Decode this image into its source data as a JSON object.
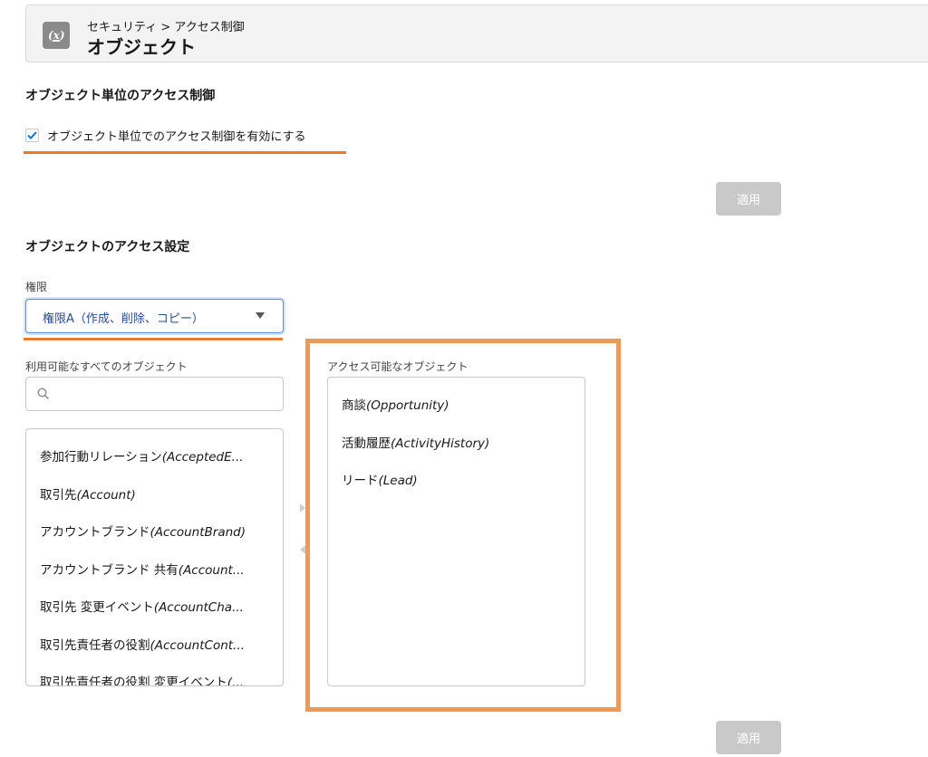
{
  "header": {
    "breadcrumb": "セキュリティ > アクセス制御",
    "title": "オブジェクト",
    "icon": "variable-icon"
  },
  "object_level": {
    "section_title": "オブジェクト単位のアクセス制御",
    "checkbox_label": "オブジェクト単位でのアクセス制御を有効にする",
    "checkbox_checked": true,
    "apply_label": "適用"
  },
  "access_settings": {
    "section_title": "オブジェクトのアクセス設定",
    "permission_label": "権限",
    "permission_value": "権限A（作成、削除、コピー）",
    "available_label": "利用可能なすべてのオブジェクト",
    "available_items": [
      {
        "jp": "参加行動リレーション",
        "en": "(AcceptedE..."
      },
      {
        "jp": "取引先",
        "en": "(Account)"
      },
      {
        "jp": "アカウントブランド",
        "en": "(AccountBrand)"
      },
      {
        "jp": "アカウントブランド 共有",
        "en": "(Account..."
      },
      {
        "jp": "取引先 変更イベント",
        "en": "(AccountCha..."
      },
      {
        "jp": "取引先責任者の役割",
        "en": "(AccountCont..."
      },
      {
        "jp": "取引先責任者の役割 変更イベント",
        "en": "(..."
      }
    ],
    "accessible_label": "アクセス可能なオブジェクト",
    "accessible_items": [
      {
        "jp": "商談",
        "en": "(Opportunity)"
      },
      {
        "jp": "活動履歴",
        "en": "(ActivityHistory)"
      },
      {
        "jp": "リード",
        "en": "(Lead)"
      }
    ],
    "apply_label": "適用"
  },
  "colors": {
    "accent_orange": "#ea7a28",
    "frame_orange": "#ec9a5a",
    "checkbox_blue": "#0176d3",
    "disabled_button": "#c9c9c9"
  }
}
